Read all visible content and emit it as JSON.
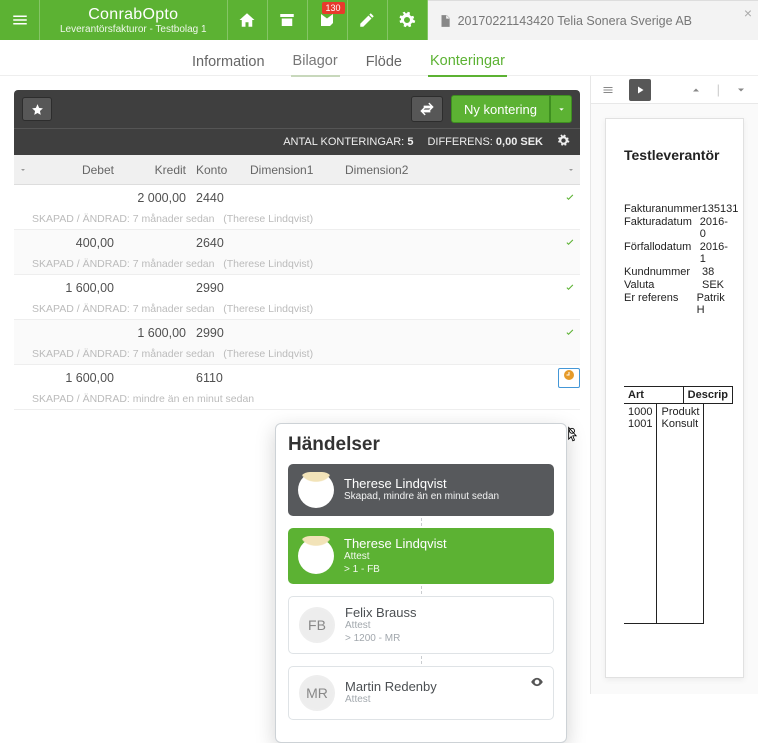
{
  "brand": {
    "title": "ConrabOpto",
    "subtitle": "Leverantörsfakturor - Testbolag 1"
  },
  "inbox_badge": "130",
  "doc_tab": {
    "label": "20170221143420 Telia Sonera Sverige AB"
  },
  "tabs": [
    {
      "label": "Information"
    },
    {
      "label": "Bilagor"
    },
    {
      "label": "Flöde"
    },
    {
      "label": "Konteringar",
      "active": true
    }
  ],
  "panel": {
    "new_label": "Ny kontering",
    "summary_count_label": "ANTAL KONTERINGAR:",
    "summary_count_value": "5",
    "summary_diff_label": "DIFFERENS:",
    "summary_diff_value": "0,00 SEK"
  },
  "headers": {
    "debet": "Debet",
    "kredit": "Kredit",
    "konto": "Konto",
    "dim1": "Dimension1",
    "dim2": "Dimension2"
  },
  "rows": [
    {
      "debet": "",
      "kredit": "2 000,00",
      "konto": "2440",
      "meta_label": "SKAPAD / ÄNDRAD:",
      "meta_age": "7 månader sedan",
      "meta_user": "(Therese Lindqvist)"
    },
    {
      "debet": "400,00",
      "kredit": "",
      "konto": "2640",
      "meta_label": "SKAPAD / ÄNDRAD:",
      "meta_age": "7 månader sedan",
      "meta_user": "(Therese Lindqvist)"
    },
    {
      "debet": "1 600,00",
      "kredit": "",
      "konto": "2990",
      "meta_label": "SKAPAD / ÄNDRAD:",
      "meta_age": "7 månader sedan",
      "meta_user": "(Therese Lindqvist)"
    },
    {
      "debet": "",
      "kredit": "1 600,00",
      "konto": "2990",
      "meta_label": "SKAPAD / ÄNDRAD:",
      "meta_age": "7 månader sedan",
      "meta_user": "(Therese Lindqvist)"
    },
    {
      "debet": "1 600,00",
      "kredit": "",
      "konto": "6110",
      "meta_label": "SKAPAD / ÄNDRAD:",
      "meta_age": "mindre än en minut sedan",
      "meta_user": ""
    }
  ],
  "popover": {
    "title": "Händelser",
    "events": [
      {
        "name": "Therese Lindqvist",
        "sub": "Skapad, mindre än en minut sedan",
        "style": "dark",
        "avatar": "face"
      },
      {
        "name": "Therese Lindqvist",
        "sub1": "Attest",
        "sub2": "> 1 - FB",
        "style": "green",
        "avatar": "face"
      },
      {
        "name": "Felix Brauss",
        "sub1": "Attest",
        "sub2": "> 1200 - MR",
        "style": "plain",
        "avatar": "FB"
      },
      {
        "name": "Martin Redenby",
        "sub1": "Attest",
        "style": "plain",
        "avatar": "MR",
        "eye": true
      }
    ]
  },
  "preview": {
    "vendor": "Testleverantör",
    "fields": [
      {
        "k": "Fakturanummer",
        "v": "135131"
      },
      {
        "k": "Fakturadatum",
        "v": "2016-0"
      },
      {
        "k": "Förfallodatum",
        "v": "2016-1"
      },
      {
        "k": "Kundnummer",
        "v": "38"
      },
      {
        "k": "Valuta",
        "v": "SEK"
      },
      {
        "k": "Er referens",
        "v": "Patrik H"
      }
    ],
    "item_headers": {
      "art": "Art",
      "desc": "Descrip"
    },
    "items": [
      {
        "art": "1000",
        "desc": "Produkt"
      },
      {
        "art": "1001",
        "desc": "Konsult"
      }
    ]
  }
}
